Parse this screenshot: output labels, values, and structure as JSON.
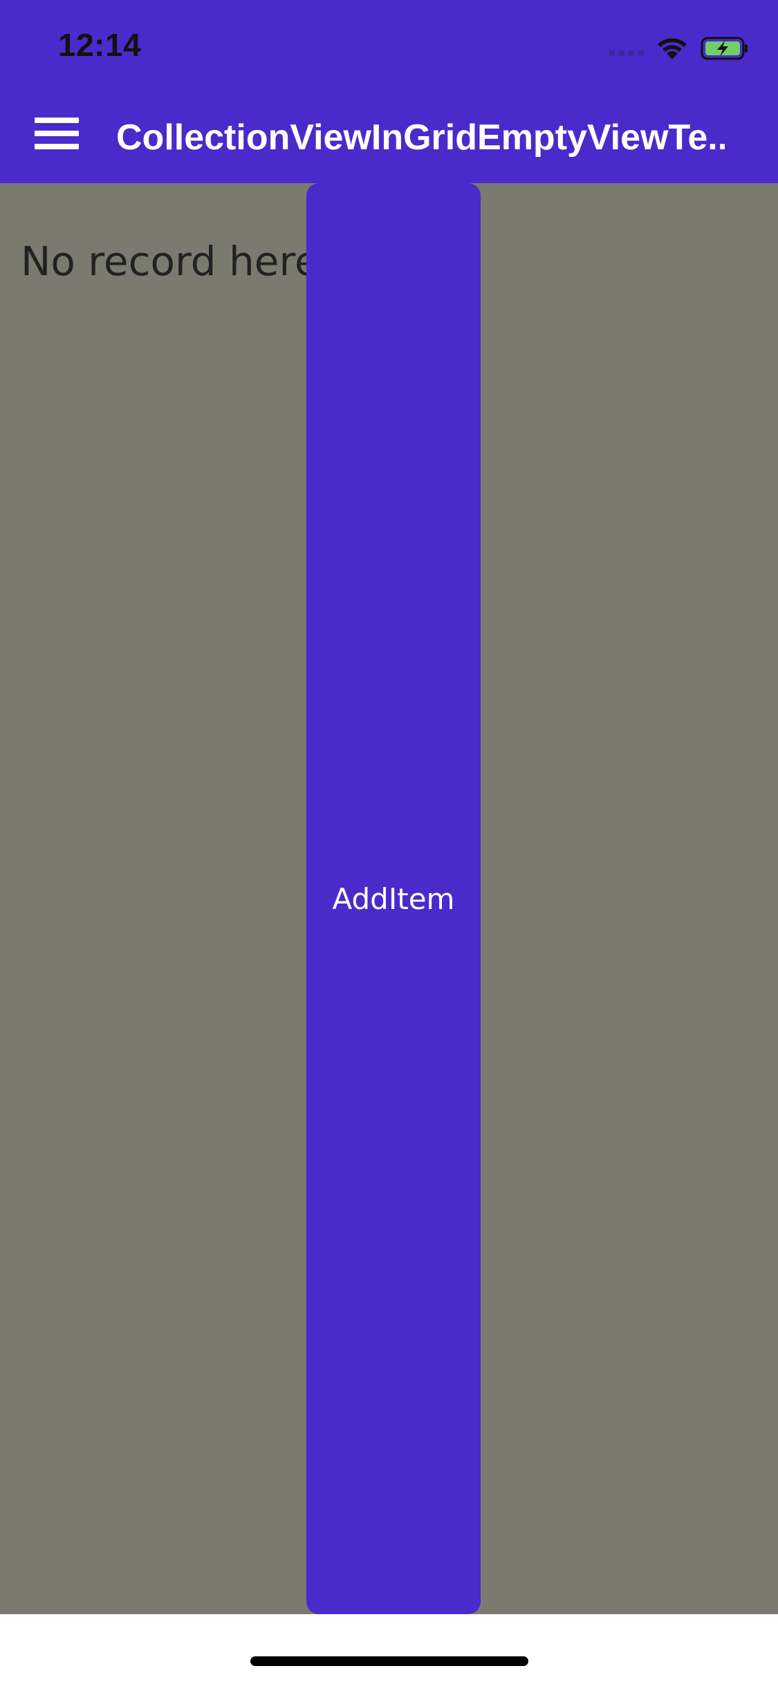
{
  "status_bar": {
    "time": "12:14",
    "icons": [
      "cellular-signal-icon",
      "wifi-icon",
      "battery-charging-icon"
    ]
  },
  "nav_bar": {
    "menu_icon": "hamburger-menu-icon",
    "title": "CollectionViewInGridEmptyViewTe..."
  },
  "content": {
    "empty_view_text": "No record here",
    "add_button_label": "AddItem"
  },
  "colors": {
    "accent": "#4a2acb",
    "content_background": "#7a7a6f",
    "battery_fill": "#6fce6a"
  }
}
